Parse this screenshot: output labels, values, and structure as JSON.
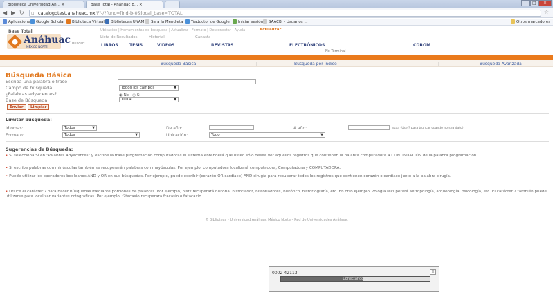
{
  "browser": {
    "tabs": [
      {
        "label": "Biblioteca Universidad An... ×"
      },
      {
        "label": "Base Total - Anáhuac B... ×"
      },
      {
        "label": ""
      }
    ],
    "window_buttons": [
      "–",
      "□",
      "×"
    ],
    "url_host": "catalogotest.anahuac.mx",
    "url_path": "/F/-/?func=find-b-0&local_base=TOTAL",
    "bookmarks": [
      {
        "label": "Aplicaciones",
        "color": "#5a8ad8"
      },
      {
        "label": "Google Scholar",
        "color": "#4a90d9"
      },
      {
        "label": "Biblioteca Virtual ...",
        "color": "#e1781e"
      },
      {
        "label": "Bibliotecas UNAM",
        "color": "#3b6fb6"
      },
      {
        "label": "Sara la Mendieta",
        "color": "#cccccc"
      },
      {
        "label": "Traductor de Google",
        "color": "#4a90d9"
      },
      {
        "label": "Iniciar sesión",
        "color": "#6aa84f"
      },
      {
        "label": "SAACBI - Usuarios ...",
        "color": "#cccccc"
      },
      {
        "label": "Otros marcadores",
        "color": "#e8c45a"
      }
    ]
  },
  "header": {
    "logo_small": "Base Total",
    "logo_text": "Anáhuac",
    "logo_sub": "MÉXICO NORTE",
    "buscar": "Buscar:",
    "top_links": "Ubicación  |  Herramientas de búsqueda  |  Actualizar  |  Formato  |  Desconectar  |  Ayuda",
    "mid_links": [
      {
        "label": "Lista de Resultados",
        "highlight": false
      },
      {
        "label": "Historial",
        "highlight": false
      },
      {
        "label": "Canasta",
        "highlight": false
      },
      {
        "label": "Actualizar",
        "highlight": true
      }
    ],
    "categories": [
      "LIBROS",
      "TESIS",
      "VIDEOS",
      "REVISTAS",
      "ELECTRÓNICOS",
      "CDROM"
    ],
    "categories_sub": "No Terminal"
  },
  "search_tabs": [
    "Búsqueda Básica",
    "Búsqueda por Índice",
    "Búsqueda Avanzada"
  ],
  "form": {
    "title": "Búsqueda Básica",
    "label_word": "Escriba una palabra o frase",
    "label_field": "Campo de búsqueda",
    "label_adjacent": "¿Palabras adyacentes?",
    "label_base": "Base de Búsqueda",
    "field_value": "Todos los campos",
    "adjacent_no": "No",
    "adjacent_yes": "Sí",
    "base_value": "TOTAL",
    "btn_search": "Enviar",
    "btn_clear": "Limpiar"
  },
  "limits": {
    "title": "Limitar búsqueda:",
    "language_label": "Idiomas:",
    "language_value": "Todos",
    "format_label": "Formato:",
    "format_value": "Todos",
    "year_from_label": "De año:",
    "year_to_label": "A año:",
    "location_label": "Ubicación:",
    "location_value": "Todo",
    "year_note": "aaaa (Use ? para truncar cuando no sea dato)"
  },
  "suggestions": {
    "title": "Sugerencias de Búsqueda:",
    "items": [
      "Si selecciona Sí en \"Palabras Adyacentes\" y escribe la frase programación computadoras el sistema entenderá que usted sólo desea ver aquellos registros que contienen la palabra computadora A CONTINUACIÓN de la palabra programación.",
      "Si escribe palabras con minúsculas también se recuperarán palabras con mayúsculas. Por ejemplo, computadora localizará computadora, Computadora y COMPUTADORA.",
      "Puede utilizar los operadores booleanos AND y OR en sus búsquedas. Por ejemplo, puede escribir (corazón OR cardiaco) AND cirugía para recuperar todos los registros que contienen corazón o cardiaco junto a la palabra cirugía.",
      "Utilice el carácter ? para hacer búsquedas mediante porciones de palabras. Por ejemplo, hist? recuperará historia, historiador, historiadores, histórico, historiografía, etc. En otro ejemplo, ?ología recuperará antropología, arqueología, psicología, etc. El carácter ? también puede utilizarse para localizar variantes ortográficas. Por ejemplo, f?tacaxio recuperará fracasio o fatacaxio."
    ]
  },
  "footer": "© Biblioteca - Universidad Anáhuac México Norte - Red de Universidades Anáhuac",
  "popup": {
    "label": "0002-42113",
    "progress_text": "Conectando ...",
    "progress": 0.55
  }
}
